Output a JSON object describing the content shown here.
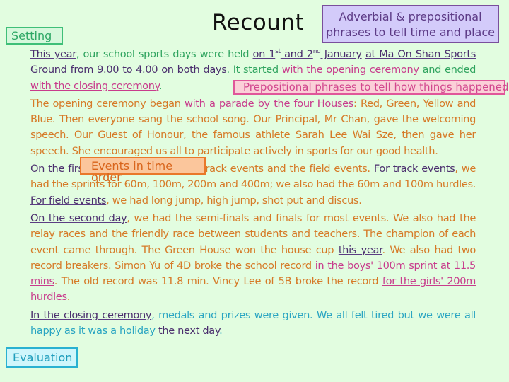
{
  "title": "Recount",
  "labels": {
    "setting": "Setting",
    "adverbial_line1": "Adverbial & prepositional",
    "adverbial_line2": "phrases to tell time and place",
    "prepositional_how": "Prepositional phrases to tell how things happened",
    "events": "Events in time order",
    "evaluation": "Evaluation"
  },
  "colors": {
    "background": "#e2fde0",
    "setting": "#2ea866",
    "time_place": "#4b2f6e",
    "how": "#c83c8c",
    "events": "#d67a27",
    "evaluation": "#2aa5c2"
  },
  "paragraphs": [
    {
      "name": "setting-paragraph",
      "segments": [
        {
          "t": "This year",
          "s": "time"
        },
        {
          "t": ", our school sports days were held ",
          "s": "green"
        },
        {
          "t": "on 1",
          "s": "time"
        },
        {
          "t": "st",
          "s": "time",
          "sup": true
        },
        {
          "t": " and 2",
          "s": "time"
        },
        {
          "t": "nd",
          "s": "time",
          "sup": true
        },
        {
          "t": " January",
          "s": "time"
        },
        {
          "t": " ",
          "s": "green"
        },
        {
          "t": "at Ma On Shan Sports Ground",
          "s": "time"
        },
        {
          "t": " ",
          "s": "green"
        },
        {
          "t": "from 9.00 to 4.00",
          "s": "time"
        },
        {
          "t": " ",
          "s": "green"
        },
        {
          "t": "on both days",
          "s": "time"
        },
        {
          "t": ". It started ",
          "s": "green"
        },
        {
          "t": "with the opening ceremony",
          "s": "how"
        },
        {
          "t": " and ended ",
          "s": "green"
        },
        {
          "t": "with the closing ceremony",
          "s": "how"
        },
        {
          "t": ".",
          "s": "green"
        }
      ]
    },
    {
      "name": "opening-ceremony-paragraph",
      "segments": [
        {
          "t": "The opening ceremony began ",
          "s": "orange"
        },
        {
          "t": "with a parade",
          "s": "how"
        },
        {
          "t": " ",
          "s": "orange"
        },
        {
          "t": "by the four Houses",
          "s": "how"
        },
        {
          "t": ": Red, Green, Yellow and Blue. Then everyone sang the school song. Our Principal, Mr Chan, gave the welcoming speech. Our Guest of Honour, the famous athlete Sarah Lee Wai Sze, then gave her speech. She encouraged us all to participate actively in sports for our good health.",
          "s": "orange"
        }
      ]
    },
    {
      "name": "first-day-paragraph",
      "segments": [
        {
          "t": "On the first day",
          "s": "time"
        },
        {
          "t": ", we had both the track events and the field events. ",
          "s": "orange"
        },
        {
          "t": "For track events",
          "s": "time"
        },
        {
          "t": ", we had the sprints for 60m, 100m, 200m and 400m; we also had the 60m and 100m hurdles. ",
          "s": "orange"
        },
        {
          "t": "For field events",
          "s": "time"
        },
        {
          "t": ", we had long jump, high jump, shot put and discus.",
          "s": "orange"
        }
      ]
    },
    {
      "name": "second-day-paragraph",
      "segments": [
        {
          "t": "On the second day",
          "s": "time"
        },
        {
          "t": ", we had the semi-finals and finals for most events. We also had the relay races and the friendly race between students and teachers. The champion of each event came through. The Green House won the house cup ",
          "s": "orange"
        },
        {
          "t": "this year",
          "s": "time"
        },
        {
          "t": ". We also had two record breakers. Simon Yu of 4D broke the school record ",
          "s": "orange"
        },
        {
          "t": "in the boys' 100m sprint at 11.5 mins",
          "s": "how"
        },
        {
          "t": ". The old record was 11.8 min. Vincy Lee of 5B broke the record ",
          "s": "orange"
        },
        {
          "t": "for the girls' 200m hurdles",
          "s": "how"
        },
        {
          "t": ".",
          "s": "orange"
        }
      ]
    },
    {
      "name": "closing-paragraph",
      "segments": [
        {
          "t": "In the closing ceremony",
          "s": "time"
        },
        {
          "t": ", medals and prizes were given. We all felt tired but we were all happy as it was a holiday ",
          "s": "teal"
        },
        {
          "t": "the next day",
          "s": "time"
        },
        {
          "t": ".",
          "s": "teal"
        }
      ]
    }
  ]
}
